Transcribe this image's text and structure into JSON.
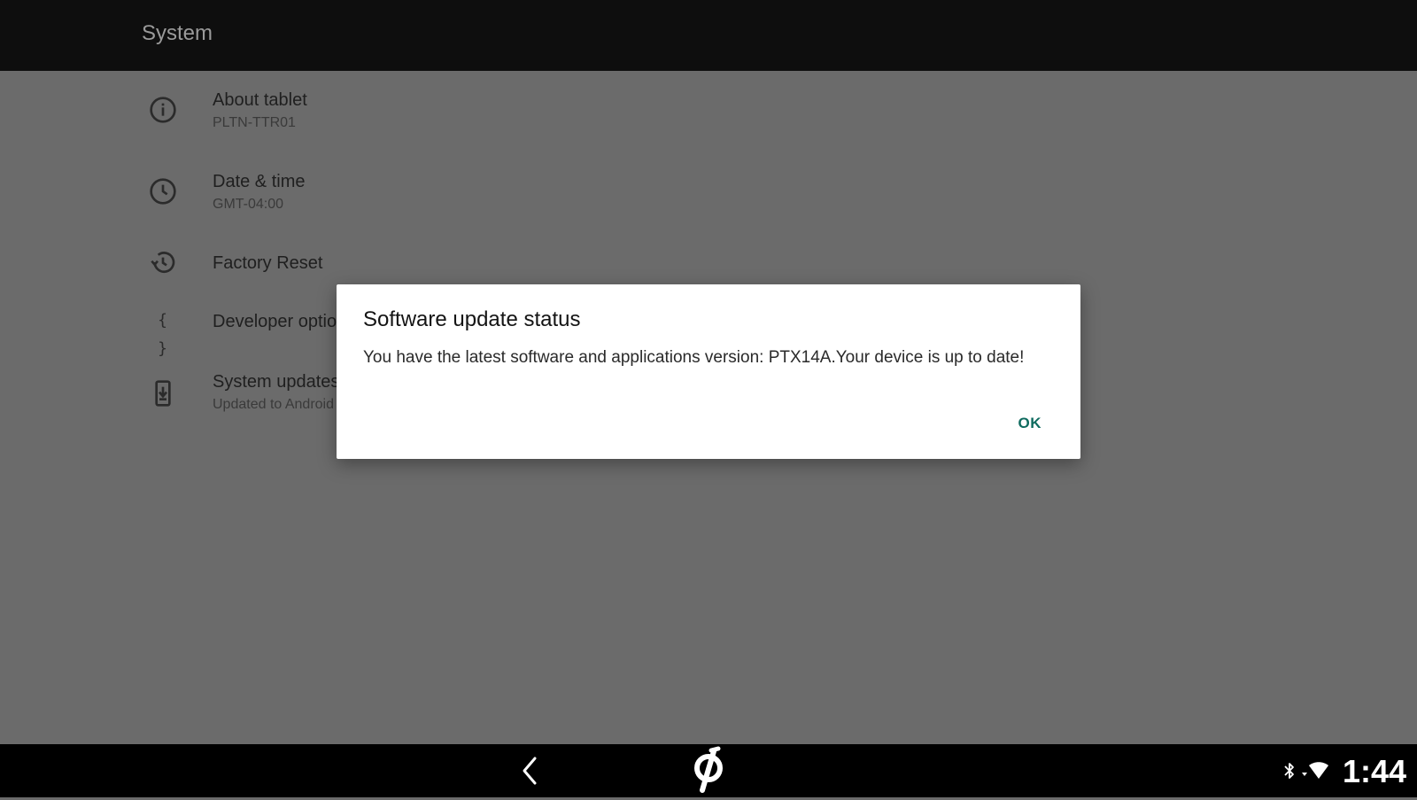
{
  "app_bar": {
    "title": "System"
  },
  "settings": {
    "items": [
      {
        "icon": "info-icon",
        "title": "About tablet",
        "summary": "PLTN-TTR01"
      },
      {
        "icon": "clock-icon",
        "title": "Date & time",
        "summary": "GMT-04:00"
      },
      {
        "icon": "history-icon",
        "title": "Factory Reset",
        "summary": ""
      },
      {
        "icon": "braces-icon",
        "title": "Developer options",
        "summary": ""
      },
      {
        "icon": "system-update-icon",
        "title": "System updates",
        "summary": "Updated to Android 10"
      }
    ]
  },
  "dialog": {
    "title": "Software update status",
    "message": "You have the latest software and applications version: PTX14A.Your device is up to date!",
    "ok_label": "OK"
  },
  "nav_bar": {
    "back_icon": "back-icon",
    "home_icon": "peloton-logo-icon"
  },
  "status_bar": {
    "icons": [
      "bluetooth-icon",
      "wifi-icon"
    ],
    "time": "1:44"
  },
  "colors": {
    "accent": "#0f6b5f",
    "scrim": "#6b6b6b",
    "bar": "#0e0e0e"
  }
}
